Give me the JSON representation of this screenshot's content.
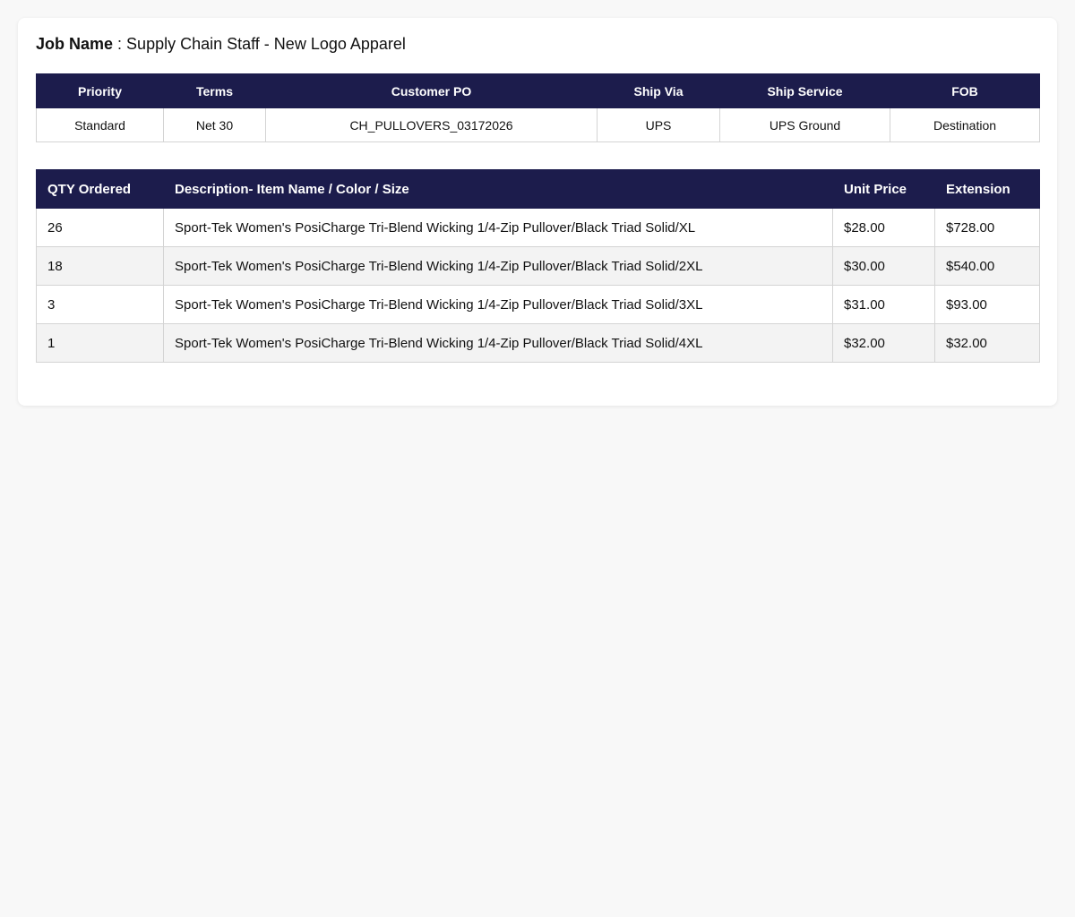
{
  "job": {
    "label": "Job Name",
    "separator": " : ",
    "value": "Supply Chain Staff - New Logo Apparel"
  },
  "order_info": {
    "headers": [
      "Priority",
      "Terms",
      "Customer PO",
      "Ship Via",
      "Ship Service",
      "FOB"
    ],
    "values": [
      "Standard",
      "Net 30",
      "CH_PULLOVERS_03172026",
      "UPS",
      "UPS Ground",
      "Destination"
    ]
  },
  "line_items": {
    "headers": [
      "QTY Ordered",
      "Description- Item Name / Color / Size",
      "Unit Price",
      "Extension"
    ],
    "rows": [
      {
        "qty": "26",
        "description": "Sport-Tek Women's PosiCharge Tri-Blend Wicking 1/4-Zip Pullover/Black Triad Solid/XL",
        "unit_price": "$28.00",
        "extension": "$728.00"
      },
      {
        "qty": "18",
        "description": "Sport-Tek Women's PosiCharge Tri-Blend Wicking 1/4-Zip Pullover/Black Triad Solid/2XL",
        "unit_price": "$30.00",
        "extension": "$540.00"
      },
      {
        "qty": "3",
        "description": "Sport-Tek Women's PosiCharge Tri-Blend Wicking 1/4-Zip Pullover/Black Triad Solid/3XL",
        "unit_price": "$31.00",
        "extension": "$93.00"
      },
      {
        "qty": "1",
        "description": "Sport-Tek Women's PosiCharge Tri-Blend Wicking 1/4-Zip Pullover/Black Triad Solid/4XL",
        "unit_price": "$32.00",
        "extension": "$32.00"
      }
    ]
  },
  "colors": {
    "header_bg": "#1c1c4c",
    "header_text": "#ffffff",
    "page_bg": "#f8f8f8",
    "alt_row_bg": "#f3f3f3"
  }
}
